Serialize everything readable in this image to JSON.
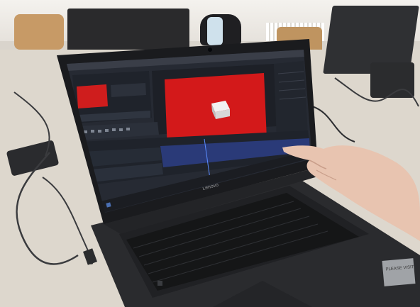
{
  "sticker": {
    "text": "PLEASE VISIT"
  },
  "brand": {
    "text": "Lenovo"
  },
  "colors": {
    "composition_red": "#d3191a",
    "app_panel": "#262a33",
    "timeline_blue": "#2a3a78",
    "taskbar": "#1b1d22"
  },
  "icons": {
    "webcam": "webcam-icon",
    "windows_key": "windows-logo-icon",
    "taskbar_start": "windows-start-icon"
  }
}
